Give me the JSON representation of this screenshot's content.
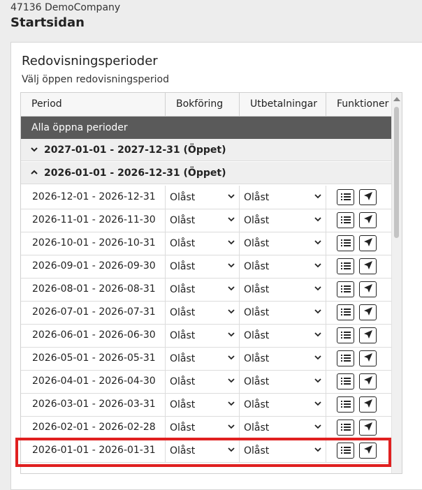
{
  "header": {
    "company": "47136 DemoCompany",
    "title": "Startsidan"
  },
  "card": {
    "title": "Redovisningsperioder",
    "subtitle": "Välj öppen redovisningsperiod"
  },
  "table": {
    "columns": {
      "period": "Period",
      "bokforing": "Bokföring",
      "utbetalningar": "Utbetalningar",
      "funktioner": "Funktioner"
    },
    "all_open": "Alla öppna perioder",
    "groups": [
      {
        "label": "2027-01-01 - 2027-12-31 (Öppet)",
        "expanded": false
      },
      {
        "label": "2026-01-01 - 2026-12-31 (Öppet)",
        "expanded": true
      }
    ],
    "rows": [
      {
        "period": "2026-12-01 - 2026-12-31",
        "bokforing": "Olåst",
        "utbetalningar": "Olåst"
      },
      {
        "period": "2026-11-01 - 2026-11-30",
        "bokforing": "Olåst",
        "utbetalningar": "Olåst"
      },
      {
        "period": "2026-10-01 - 2026-10-31",
        "bokforing": "Olåst",
        "utbetalningar": "Olåst"
      },
      {
        "period": "2026-09-01 - 2026-09-30",
        "bokforing": "Olåst",
        "utbetalningar": "Olåst"
      },
      {
        "period": "2026-08-01 - 2026-08-31",
        "bokforing": "Olåst",
        "utbetalningar": "Olåst"
      },
      {
        "period": "2026-07-01 - 2026-07-31",
        "bokforing": "Olåst",
        "utbetalningar": "Olåst"
      },
      {
        "period": "2026-06-01 - 2026-06-30",
        "bokforing": "Olåst",
        "utbetalningar": "Olåst"
      },
      {
        "period": "2026-05-01 - 2026-05-31",
        "bokforing": "Olåst",
        "utbetalningar": "Olåst"
      },
      {
        "period": "2026-04-01 - 2026-04-30",
        "bokforing": "Olåst",
        "utbetalningar": "Olåst"
      },
      {
        "period": "2026-03-01 - 2026-03-31",
        "bokforing": "Olåst",
        "utbetalningar": "Olåst"
      },
      {
        "period": "2026-02-01 - 2026-02-28",
        "bokforing": "Olåst",
        "utbetalningar": "Olåst"
      },
      {
        "period": "2026-01-01 - 2026-01-31",
        "bokforing": "Olåst",
        "utbetalningar": "Olåst"
      }
    ]
  },
  "colors": {
    "highlight": "#e02020",
    "all_open_bg": "#5a5a5a"
  },
  "icons": {
    "chevron_collapsed": "chevron-down-icon",
    "chevron_expanded": "chevron-up-icon",
    "list": "list-icon",
    "send": "send-icon"
  }
}
